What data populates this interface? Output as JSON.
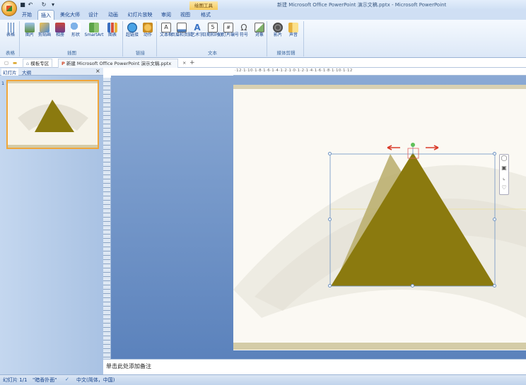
{
  "window": {
    "title": "新建 Microsoft Office PowerPoint 演示文稿.pptx - Microsoft PowerPoint",
    "contextual_tab": "绘图工具"
  },
  "ribbon_tabs": [
    "开始",
    "插入",
    "设计",
    "动画",
    "幻灯片放映",
    "审阅",
    "视图",
    "格式"
  ],
  "ribbon_tabs_extra": "美化大师",
  "active_tab": "插入",
  "ribbon_groups": {
    "tables": {
      "label": "表格",
      "buttons": [
        "表格"
      ]
    },
    "illustrations": {
      "label": "插图",
      "buttons": [
        "图片",
        "剪贴画",
        "相册",
        "形状",
        "SmartArt",
        "图表"
      ]
    },
    "links": {
      "label": "链接",
      "buttons": [
        "超链接",
        "动作"
      ]
    },
    "text": {
      "label": "文本",
      "buttons": [
        "文本框",
        "页眉和页脚",
        "艺术字",
        "日期和时间",
        "幻灯片编号",
        "符号",
        "对象"
      ]
    },
    "media": {
      "label": "媒体剪辑",
      "buttons": [
        "影片",
        "声音"
      ]
    }
  },
  "doc_tabs": {
    "template": "模板专区",
    "document": "新建 Microsoft Office PowerPoint 演示文稿.pptx",
    "add": "+"
  },
  "left_panel": {
    "tab_slides": "幻灯片",
    "tab_outline": "大纲",
    "close": "×",
    "slide_number": "1"
  },
  "ruler_text": "·12·1·10·1·8·1·6·1·4·1·2·1·0·1·2·1·4·1·6·1·8·1·10·1·12",
  "notes_placeholder": "单击此处添加备注",
  "status": {
    "slide": "幻灯片 1/1",
    "theme": "\"暗香扑面\"",
    "language": "中文(简体，中国)"
  },
  "colors": {
    "ribbon_bg": "#dce8f7",
    "workspace": "#6f92c6",
    "shape_fill": "#8b7a0f",
    "shape_ghost": "#b8ad6a",
    "selection": "#6e93c3",
    "thumb_border": "#f0a63b"
  }
}
